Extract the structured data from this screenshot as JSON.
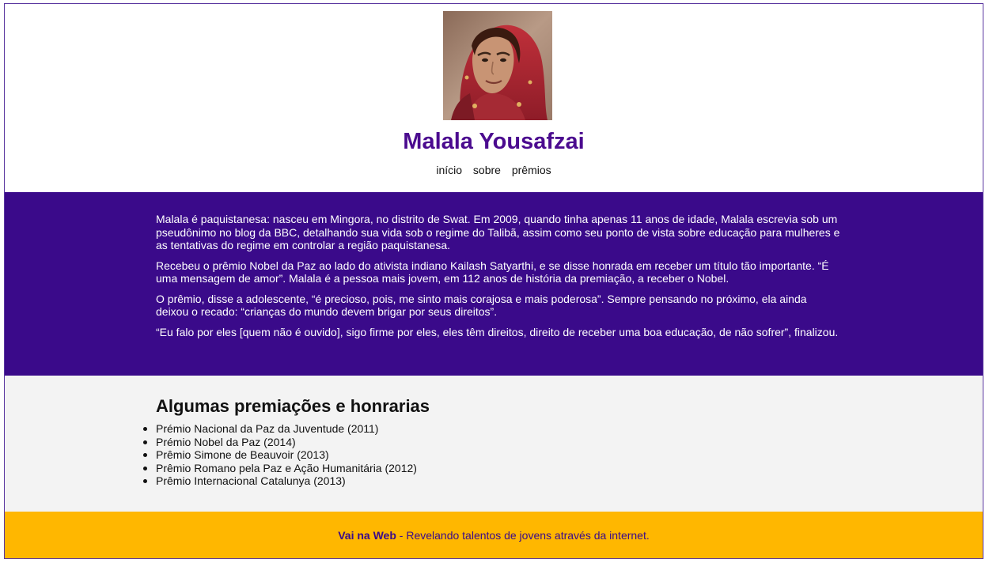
{
  "header": {
    "portrait_alt": "Malala Yousafzai",
    "title": "Malala Yousafzai",
    "nav": [
      {
        "label": "início"
      },
      {
        "label": "sobre"
      },
      {
        "label": "prêmios"
      }
    ]
  },
  "bio": {
    "paragraphs": [
      "Malala é paquistanesa: nasceu em Mingora, no distrito de Swat. Em 2009, quando tinha apenas 11 anos de idade, Malala escrevia sob um pseudônimo no blog da BBC, detalhando sua vida sob o regime do Talibã, assim como seu ponto de vista sobre educação para mulheres e as tentativas do regime em controlar a região paquistanesa.",
      "Recebeu o prêmio Nobel da Paz ao lado do ativista indiano Kailash Satyarthi, e se disse honrada em receber um título tão importante. “É uma mensagem de amor”. Malala é a pessoa mais jovem, em 112 anos de história da premiação, a receber o Nobel.",
      "O prêmio, disse a adolescente, “é precioso, pois, me sinto mais corajosa e mais poderosa”. Sempre pensando no próximo, ela ainda deixou o recado: “crianças do mundo devem brigar por seus direitos”.",
      "“Eu falo por eles [quem não é ouvido], sigo firme por eles, eles têm direitos, direito de receber uma boa educação, de não sofrer”, finalizou."
    ]
  },
  "awards": {
    "heading": "Algumas premiações e honrarias",
    "items": [
      "Prémio Nacional da Paz da Juventude (2011)",
      "Prémio Nobel da Paz (2014)",
      "Prêmio Simone de Beauvoir (2013)",
      "Prêmio Romano pela Paz e Ação Humanitária (2012)",
      "Prêmio Internacional Catalunya (2013)"
    ]
  },
  "footer": {
    "brand": "Vai na Web",
    "tagline": " - Revelando talentos de jovens através da internet."
  },
  "colors": {
    "brand_purple": "#3a0a8a",
    "title_purple": "#4b0b8f",
    "footer_yellow": "#ffb700",
    "awards_background": "#f3f3f3"
  }
}
